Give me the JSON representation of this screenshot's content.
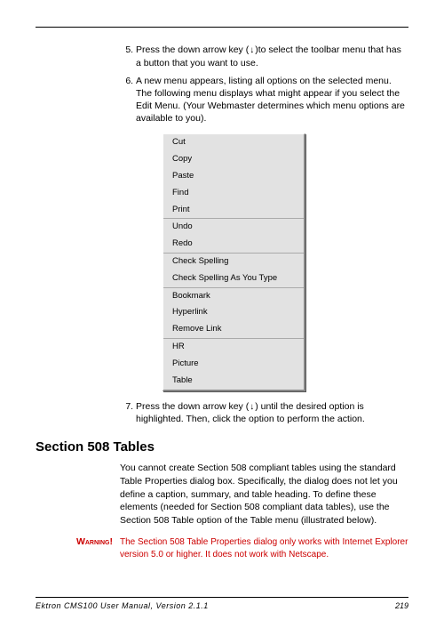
{
  "steps": {
    "start": 5,
    "item5_a": "Press the down arrow key (",
    "item5_b": ")to select the toolbar menu that has a button that you want to use.",
    "item6": "A new menu appears, listing all options on the selected menu. The following menu displays what might appear if you select the Edit Menu. (Your Webmaster determines which menu options are available to you).",
    "item7_a": "Press the down arrow key (",
    "item7_b": ") until the desired option is highlighted. Then, click the option to perform the action."
  },
  "menu": {
    "groups": [
      [
        "Cut",
        "Copy",
        "Paste",
        "Find",
        "Print"
      ],
      [
        "Undo",
        "Redo"
      ],
      [
        "Check Spelling",
        "Check Spelling As You Type"
      ],
      [
        "Bookmark",
        "Hyperlink",
        "Remove Link"
      ],
      [
        "HR",
        "Picture",
        "Table"
      ]
    ]
  },
  "section": {
    "heading": "Section 508 Tables",
    "body": "You cannot create Section 508 compliant tables using the standard Table Properties dialog box. Specifically, the dialog does not let you define a caption, summary, and table heading. To define these elements (needed for Section 508 compliant data tables), use the Section 508 Table option of the Table menu (illustrated below)."
  },
  "warning": {
    "label": "Warning!",
    "text": "The Section 508 Table Properties dialog only works with Internet Explorer version 5.0 or higher. It does not work with Netscape."
  },
  "footer": {
    "title": "Ektron CMS100 User Manual, Version 2.1.1",
    "page": "219"
  },
  "icons": {
    "down_arrow": "↓"
  }
}
